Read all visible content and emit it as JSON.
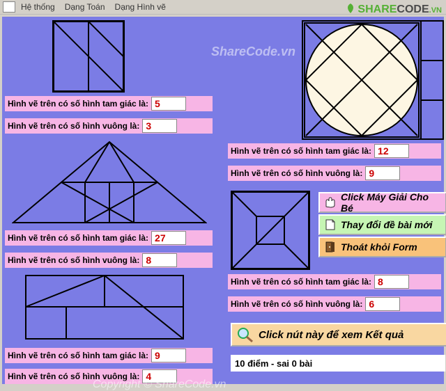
{
  "menu": {
    "system": "Hệ thống",
    "math": "Dạng Toán",
    "draw": "Dạng Hình vẽ"
  },
  "labels": {
    "triangles": "Hình vẽ trên có số hình tam giác là:",
    "squares": "Hình vẽ trên có số hình vuông là:"
  },
  "figures": {
    "a": {
      "tri": "5",
      "sq": "3"
    },
    "b": {
      "tri": "27",
      "sq": "8"
    },
    "c": {
      "tri": "9",
      "sq": "4"
    },
    "d": {
      "tri": "12",
      "sq": "9"
    },
    "e": {
      "tri": "8",
      "sq": "6"
    }
  },
  "buttons": {
    "solve": "Click Máy Giải Cho Bé",
    "new": "Thay đổi đề bài mới",
    "exit": "Thoát khỏi Form",
    "result": "Click nút này để xem Kết quả"
  },
  "resultBar": "10 điểm - sai 0 bài",
  "watermarks": {
    "url": "ShareCode.vn",
    "copy": "Copyright © ShareCode.vn"
  },
  "logo": {
    "part1": "SHARE",
    "part2": "CODE",
    "suffix": ".VN"
  }
}
